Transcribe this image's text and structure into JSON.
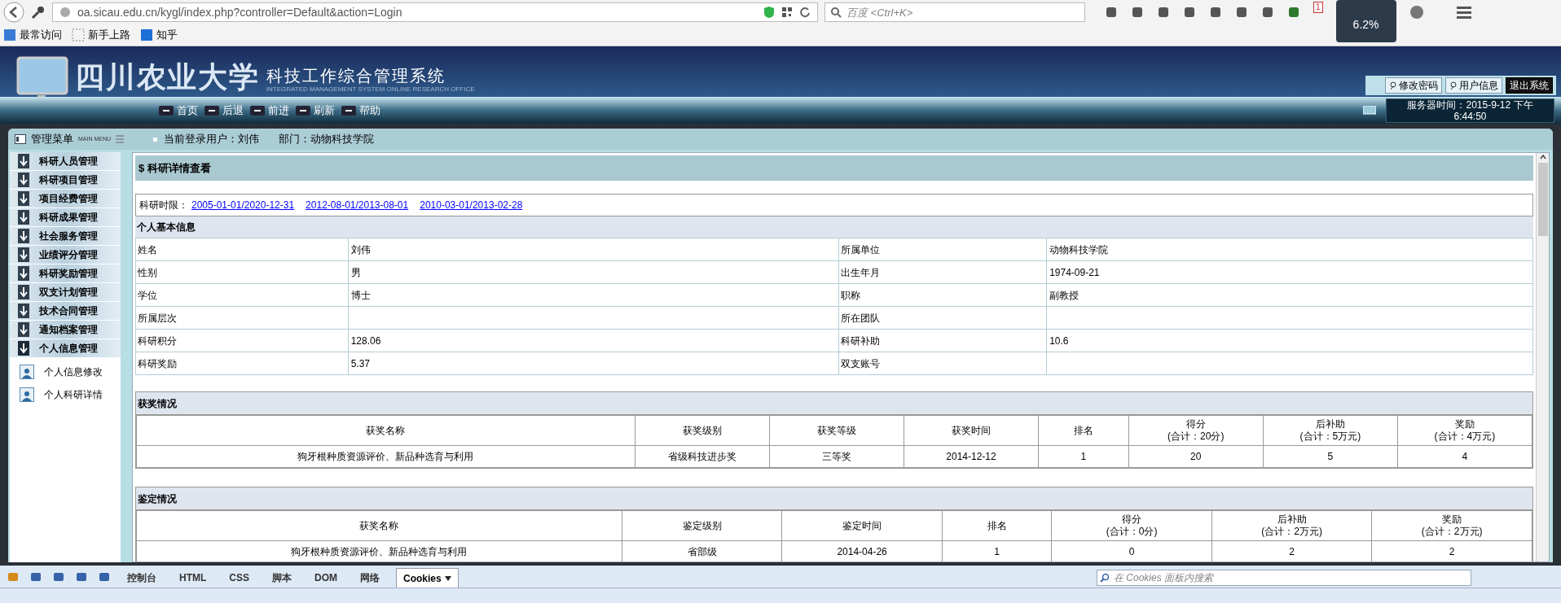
{
  "browser": {
    "url": "oa.sicau.edu.cn/kygl/index.php?controller=Default&action=Login",
    "search_placeholder": "百度 <Ctrl+K>",
    "notification_count": "1",
    "cpu_meter": "6.2%",
    "bookmarks": [
      "最常访问",
      "新手上路",
      "知乎"
    ]
  },
  "header": {
    "school": "四川农业大学",
    "system": "科技工作综合管理系统",
    "subtitle": "INTEGRATED MANAGEMENT SYSTEM ONLINE RESEARCH OFFICE",
    "account_buttons": [
      "修改密码",
      "用户信息",
      "退出系统"
    ],
    "nav": [
      "首页",
      "后退",
      "前进",
      "刷新",
      "帮助"
    ],
    "server_time": [
      "服务器时间：2015-9-12 下午",
      "6:44:50"
    ]
  },
  "sidebar": {
    "title": "管理菜单",
    "subtitle": "MAIN MENU",
    "items": [
      {
        "label": "科研人员管理",
        "expanded": false
      },
      {
        "label": "科研项目管理",
        "expanded": false
      },
      {
        "label": "项目经费管理",
        "expanded": false
      },
      {
        "label": "科研成果管理",
        "expanded": false
      },
      {
        "label": "社会服务管理",
        "expanded": false
      },
      {
        "label": "业绩评分管理",
        "expanded": false
      },
      {
        "label": "科研奖励管理",
        "expanded": false
      },
      {
        "label": "双支计划管理",
        "expanded": false
      },
      {
        "label": "技术合同管理",
        "expanded": false
      },
      {
        "label": "通知档案管理",
        "expanded": false
      },
      {
        "label": "个人信息管理",
        "expanded": true,
        "children": [
          "个人信息修改",
          "个人科研详情"
        ]
      }
    ]
  },
  "user_bar": {
    "user": "当前登录用户：刘伟",
    "department": "部门：动物科技学院"
  },
  "content": {
    "title": "$ 科研详情查看",
    "period_label": "科研时限：",
    "periods": [
      "2005-01-01/2020-12-31",
      "2012-08-01/2013-08-01",
      "2010-03-01/2013-02-28"
    ],
    "basic_info": {
      "title": "个人基本信息",
      "rows": [
        [
          "姓名",
          "刘伟",
          "所属单位",
          "动物科技学院"
        ],
        [
          "性别",
          "男",
          "出生年月",
          "1974-09-21"
        ],
        [
          "学位",
          "博士",
          "职称",
          "副教授"
        ],
        [
          "所属层次",
          "",
          "所在团队",
          ""
        ],
        [
          "科研积分",
          "128.06",
          "科研补助",
          "10.6"
        ],
        [
          "科研奖励",
          "5.37",
          "双支账号",
          ""
        ]
      ]
    },
    "tables": [
      {
        "title": "获奖情况",
        "columns": [
          "获奖名称",
          "获奖级别",
          "获奖等级",
          "获奖时间",
          "排名",
          "得分\n(合计：20分)",
          "后补助\n(合计：5万元)",
          "奖励\n(合计：4万元)"
        ],
        "rows": [
          [
            "狗牙根种质资源评价、新品种选育与利用",
            "省级科技进步奖",
            "三等奖",
            "2014-12-12",
            "1",
            "20",
            "5",
            "4"
          ]
        ]
      },
      {
        "title": "鉴定情况",
        "columns": [
          "获奖名称",
          "鉴定级别",
          "鉴定时间",
          "排名",
          "得分\n(合计：0分)",
          "后补助\n(合计：2万元)",
          "奖励\n(合计：2万元)"
        ],
        "rows": [
          [
            "狗牙根种质资源评价、新品种选育与利用",
            "省部级",
            "2014-04-26",
            "1",
            "0",
            "2",
            "2"
          ]
        ]
      }
    ]
  },
  "devtools": {
    "tabs": [
      {
        "label": "控制台",
        "selected": false
      },
      {
        "label": "HTML",
        "selected": false
      },
      {
        "label": "CSS",
        "selected": false
      },
      {
        "label": "脚本",
        "selected": false
      },
      {
        "label": "DOM",
        "selected": false
      },
      {
        "label": "网络",
        "selected": false
      },
      {
        "label": "Cookies",
        "selected": true
      }
    ],
    "search_placeholder": "在 Cookies 面板内搜索"
  }
}
